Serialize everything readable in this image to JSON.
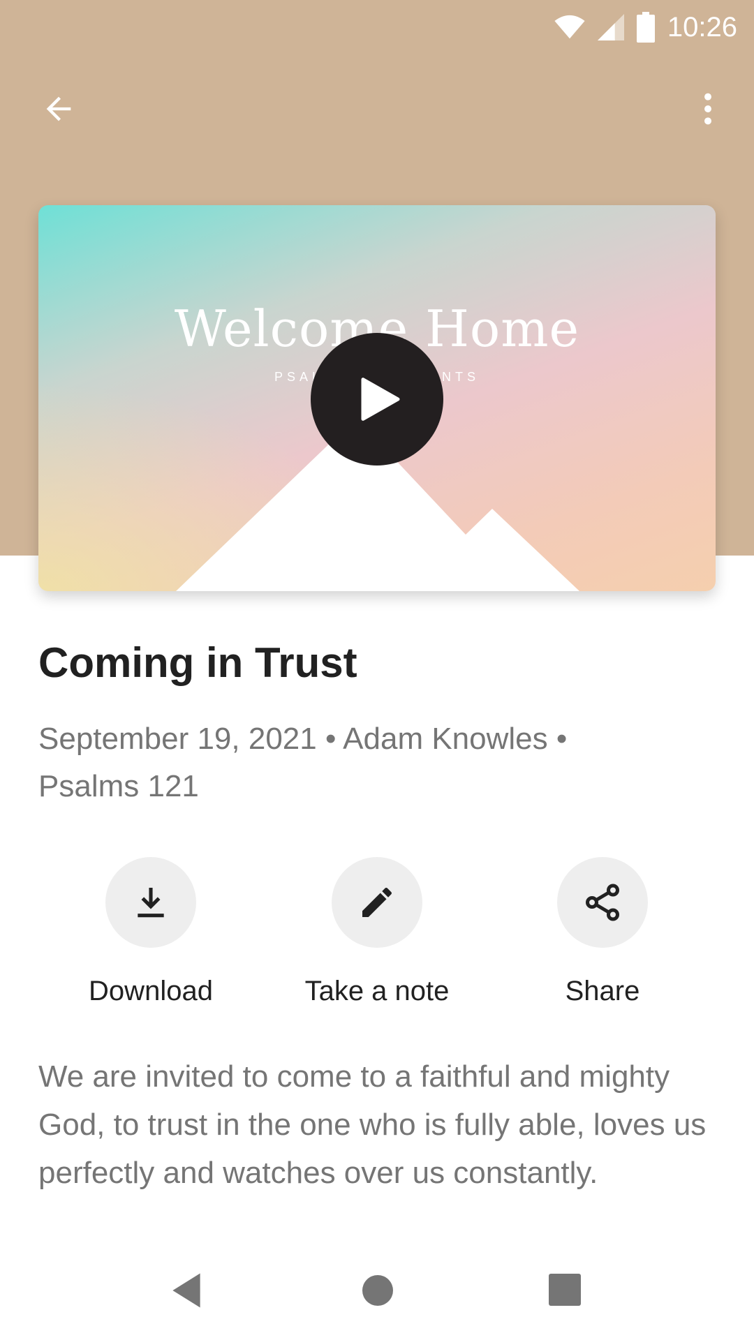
{
  "status_bar": {
    "time": "10:26"
  },
  "colors": {
    "header_bg": "#cfb497",
    "play_button": "#231f20",
    "action_circle": "#eeeeee",
    "secondary_text": "#757575"
  },
  "thumbnail": {
    "title": "Welcome Home",
    "subtitle": "PSALMS OF ASCENTS"
  },
  "sermon": {
    "title": "Coming in Trust",
    "meta_line1": "September 19, 2021 • Adam Knowles •",
    "meta_line2": "Psalms 121",
    "description": "We are invited to come to a faithful and mighty God, to trust in the one who is fully able, loves us perfectly and watches over us constantly."
  },
  "actions": [
    {
      "label": "Download",
      "icon": "download-icon"
    },
    {
      "label": "Take a note",
      "icon": "pencil-icon"
    },
    {
      "label": "Share",
      "icon": "share-icon"
    }
  ]
}
